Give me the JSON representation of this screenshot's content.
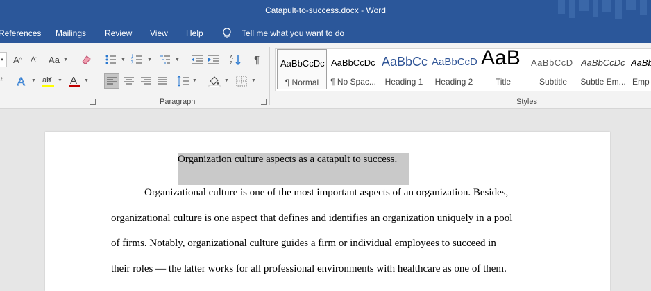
{
  "window": {
    "title": "Catapult-to-success.docx  -  Word"
  },
  "tabs": [
    {
      "label": "References"
    },
    {
      "label": "Mailings"
    },
    {
      "label": "Review"
    },
    {
      "label": "View"
    },
    {
      "label": "Help"
    }
  ],
  "tell_me": {
    "label": "Tell me what you want to do"
  },
  "ribbon": {
    "font_group": {
      "change_case_label": "Aa"
    },
    "paragraph_group": {
      "label": "Paragraph"
    },
    "styles_group": {
      "label": "Styles",
      "items": [
        {
          "preview": "AaBbCcDc",
          "name": "¶ Normal"
        },
        {
          "preview": "AaBbCcDc",
          "name": "¶ No Spac..."
        },
        {
          "preview": "AaBbCc",
          "name": "Heading 1"
        },
        {
          "preview": "AaBbCcD",
          "name": "Heading 2"
        },
        {
          "preview": "AaB",
          "name": "Title"
        },
        {
          "preview": "AaBbCcD",
          "name": "Subtitle"
        },
        {
          "preview": "AaBbCcDc",
          "name": "Subtle Em..."
        },
        {
          "preview": "AaBbCcDc",
          "name": "Emp"
        }
      ]
    }
  },
  "document": {
    "heading": "Organization culture aspects as a catapult to success.",
    "lines": [
      "Organizational culture is one of the most important aspects of an organization. Besides,",
      "organizational culture is one aspect that defines and identifies an organization uniquely in a pool",
      "of firms. Notably, organizational culture guides a firm or individual employees to succeed in",
      "their roles — the latter works for all professional environments with healthcare as one of them."
    ]
  },
  "colors": {
    "title_bar": "#2b579a",
    "ribbon": "#f3f3f3",
    "highlight": "#c9c9c9",
    "font_color_bar": "#c00000",
    "highlight_color_bar": "#ffff00"
  }
}
